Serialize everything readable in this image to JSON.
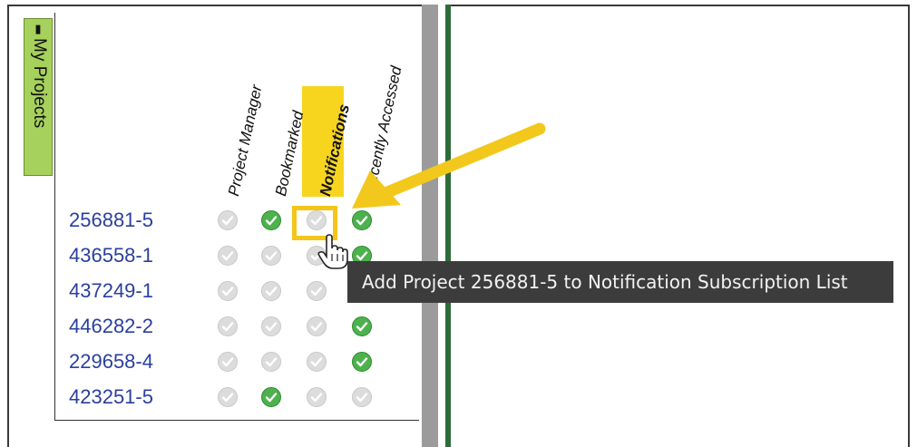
{
  "side_tab": {
    "label": "My Projects",
    "icon": "pin-icon"
  },
  "columns": [
    {
      "label": "Project Manager",
      "highlighted": false
    },
    {
      "label": "Bookmarked",
      "highlighted": false
    },
    {
      "label": "Notifications",
      "highlighted": true
    },
    {
      "label": "Recently Accessed",
      "highlighted": false
    }
  ],
  "rows": [
    {
      "project": "256881-5",
      "pm": false,
      "bookmarked": true,
      "notifications": false,
      "recent": true
    },
    {
      "project": "436558-1",
      "pm": false,
      "bookmarked": false,
      "notifications": false,
      "recent": true
    },
    {
      "project": "437249-1",
      "pm": false,
      "bookmarked": false,
      "notifications": false,
      "recent": false
    },
    {
      "project": "446282-2",
      "pm": false,
      "bookmarked": false,
      "notifications": false,
      "recent": true
    },
    {
      "project": "229658-4",
      "pm": false,
      "bookmarked": false,
      "notifications": false,
      "recent": true
    },
    {
      "project": "423251-5",
      "pm": false,
      "bookmarked": true,
      "notifications": false,
      "recent": false
    }
  ],
  "tooltip": {
    "text": "Add Project 256881-5 to Notification Subscription List"
  },
  "colors": {
    "tab": "#a6d15c",
    "highlight": "#f7d51f",
    "check_on": "#4db24d",
    "check_off": "#dcdcdc",
    "link": "#2a3f9e",
    "tooltip_bg": "#3c3c3c"
  }
}
